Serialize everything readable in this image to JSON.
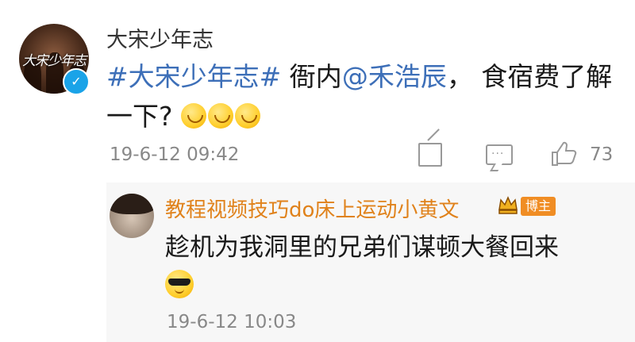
{
  "post": {
    "avatar_text": "大宋少年志",
    "username": "大宋少年志",
    "topic": "#大宋少年志#",
    "text_a": " 衙内",
    "mention": "@禾浩辰",
    "text_b": "， 食宿费了解一下?",
    "emojis": [
      "grin-emoji",
      "grin-emoji",
      "grin-emoji"
    ],
    "timestamp": "19-6-12 09:42",
    "like_count": "73",
    "icons": [
      "share-icon",
      "comment-icon",
      "like-icon",
      "verified-icon"
    ]
  },
  "reply": {
    "name": "教程视频技巧do床上运动小黄文",
    "badge": "博主",
    "text": "趁机为我洞里的兄弟们谋顿大餐回来",
    "emoji": "cool-emoji",
    "timestamp": "19-6-12 10:03"
  },
  "colors": {
    "link": "#3d6fb8",
    "reply_name": "#e0821b",
    "badge_bg": "#f08d24",
    "meta": "#888888"
  }
}
